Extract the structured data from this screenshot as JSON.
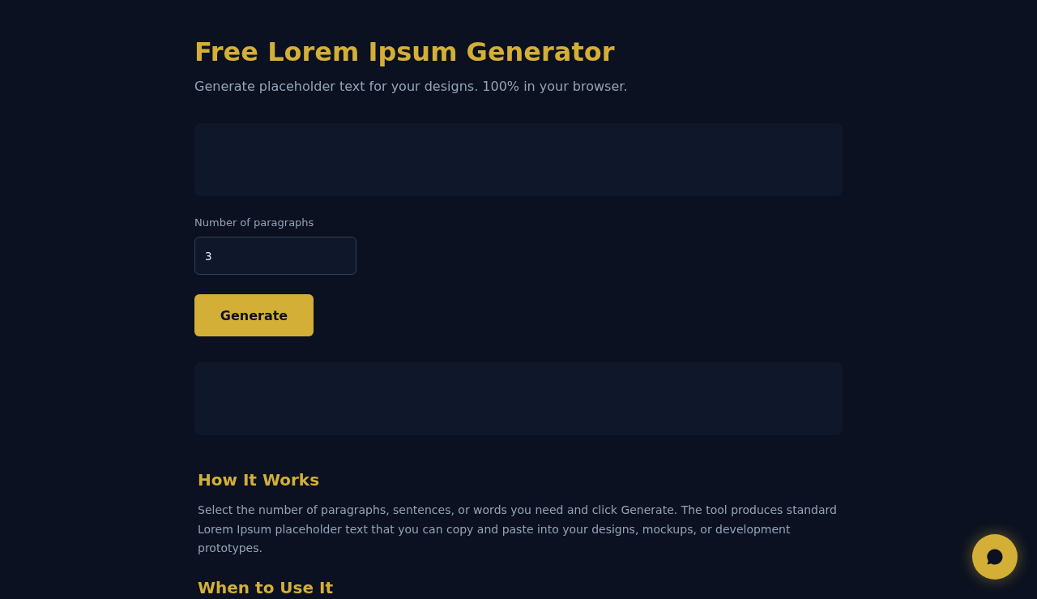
{
  "header": {
    "title": "Free Lorem Ipsum Generator",
    "subtitle": "Generate placeholder text for your designs. 100% in your browser."
  },
  "paragraph_field": {
    "label": "Number of paragraphs",
    "value": "3"
  },
  "generate_button": {
    "label": "Generate"
  },
  "sections": [
    {
      "heading": "How It Works",
      "text": "Select the number of paragraphs, sentences, or words you need and click Generate. The tool produces standard Lorem Ipsum placeholder text that you can copy and paste into your designs, mockups, or development prototypes."
    },
    {
      "heading": "When to Use It"
    }
  ]
}
